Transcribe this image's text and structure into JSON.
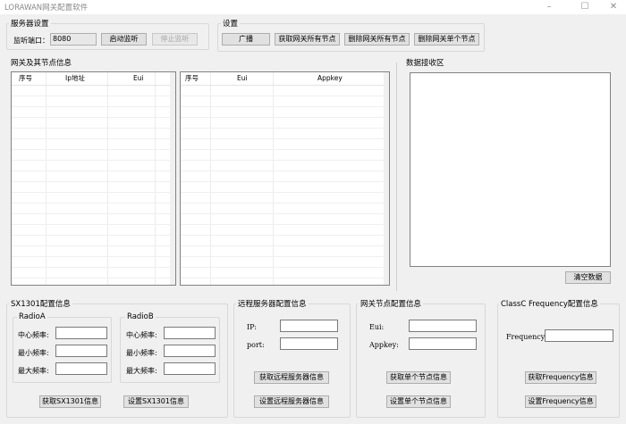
{
  "window": {
    "title": "LORAWAN网关配置软件",
    "minimize": "–",
    "maximize": "☐",
    "close": "✕"
  },
  "server": {
    "group": "服务器设置",
    "port_label": "监听端口：",
    "port_value": "8080",
    "start_btn": "启动监听",
    "stop_btn": "停止监听"
  },
  "settings": {
    "group": "设置",
    "broadcast_btn": "广播",
    "get_all_btn": "获取网关所有节点",
    "delete_all_btn": "删除网关所有节点",
    "delete_one_btn": "删除网关单个节点"
  },
  "gateway_list": {
    "title": "网关及其节点信息",
    "table1_headers": [
      "序号",
      "Ip地址",
      "Eui"
    ],
    "table2_headers": [
      "序号",
      "Eui",
      "Appkey"
    ]
  },
  "receive": {
    "title": "数据接收区",
    "clear_btn": "清空数据"
  },
  "sx1301": {
    "group": "SX1301配置信息",
    "radioA": {
      "title": "RadioA",
      "center": "中心频率:",
      "min": "最小频率:",
      "max": "最大频率:"
    },
    "radioB": {
      "title": "RadioB",
      "center": "中心频率:",
      "min": "最小频率:",
      "max": "最大频率:"
    },
    "get_btn": "获取SX1301信息",
    "set_btn": "设置SX1301信息"
  },
  "remote": {
    "group": "远程服务器配置信息",
    "ip_label": "IP:",
    "port_label": "port:",
    "get_btn": "获取远程服务器信息",
    "set_btn": "设置远程服务器信息"
  },
  "node": {
    "group": "网关节点配置信息",
    "eui_label": "Eui:",
    "appkey_label": "Appkey:",
    "get_btn": "获取单个节点信息",
    "set_btn": "设置单个节点信息"
  },
  "classc": {
    "group": "ClassC Frequency配置信息",
    "freq_label": "Frequency:",
    "get_btn": "获取Frequency信息",
    "set_btn": "设置Frequency信息"
  }
}
